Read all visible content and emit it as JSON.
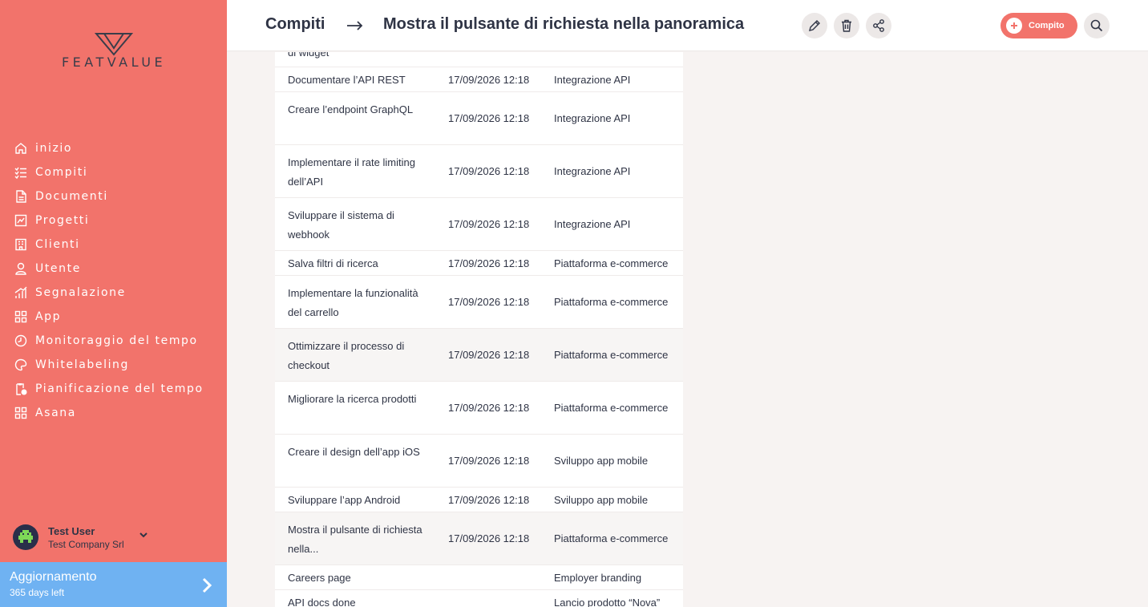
{
  "app": {
    "logo_text": "FEATVALUE"
  },
  "sidebar": {
    "items": [
      {
        "label": "inizio",
        "icon": "home-icon"
      },
      {
        "label": "Compiti",
        "icon": "tasks-icon"
      },
      {
        "label": "Documenti",
        "icon": "documents-icon"
      },
      {
        "label": "Progetti",
        "icon": "projects-icon"
      },
      {
        "label": "Clienti",
        "icon": "clients-icon"
      },
      {
        "label": "Utente",
        "icon": "user-icon"
      },
      {
        "label": "Segnalazione",
        "icon": "reporting-icon"
      },
      {
        "label": "App",
        "icon": "apps-icon"
      },
      {
        "label": "Monitoraggio del tempo",
        "icon": "time-tracking-icon"
      },
      {
        "label": "Whitelabeling",
        "icon": "whitelabel-icon"
      },
      {
        "label": "Pianificazione del tempo",
        "icon": "time-planning-icon"
      },
      {
        "label": "Asana",
        "icon": "asana-icon"
      }
    ]
  },
  "user": {
    "name": "Test User",
    "company": "Test Company Srl"
  },
  "upgrade": {
    "title": "Aggiornamento",
    "subtitle": "365 days left"
  },
  "header": {
    "breadcrumb": "Compiti",
    "title": "Mostra il pulsante di richiesta nella panoramica",
    "add_label": "Compito"
  },
  "table": {
    "rows": [
      {
        "name": "di widget",
        "date": "",
        "project": ""
      },
      {
        "name": "Documentare l’API REST",
        "date": "17/09/2026 12:18",
        "project": "Integrazione API"
      },
      {
        "name": "Creare l’endpoint GraphQL",
        "date": "17/09/2026 12:18",
        "project": "Integrazione API"
      },
      {
        "name": "Implementare il rate limiting dell’API",
        "date": "17/09/2026 12:18",
        "project": "Integrazione API"
      },
      {
        "name": "Sviluppare il sistema di webhook",
        "date": "17/09/2026 12:18",
        "project": "Integrazione API"
      },
      {
        "name": "Salva filtri di ricerca",
        "date": "17/09/2026 12:18",
        "project": "Piattaforma e-commerce"
      },
      {
        "name": "Implementare la funzionalità del carrello",
        "date": "17/09/2026 12:18",
        "project": "Piattaforma e-commerce"
      },
      {
        "name": "Ottimizzare il processo di checkout",
        "date": "17/09/2026 12:18",
        "project": "Piattaforma e-commerce"
      },
      {
        "name": "Migliorare la ricerca prodotti",
        "date": "17/09/2026 12:18",
        "project": "Piattaforma e-commerce"
      },
      {
        "name": "Creare il design dell’app iOS",
        "date": "17/09/2026 12:18",
        "project": "Sviluppo app mobile"
      },
      {
        "name": "Sviluppare l’app Android",
        "date": "17/09/2026 12:18",
        "project": "Sviluppo app mobile"
      },
      {
        "name": "Mostra il pulsante di richiesta nella...",
        "date": "17/09/2026 12:18",
        "project": "Piattaforma e-commerce"
      },
      {
        "name": "Careers page",
        "date": "",
        "project": "Employer branding"
      },
      {
        "name": "API docs done",
        "date": "",
        "project": "Lancio prodotto “Nova”"
      }
    ]
  },
  "colors": {
    "sidebar": "#f2736b",
    "upgrade": "#6fb2f2",
    "accent": "#f2736b"
  }
}
